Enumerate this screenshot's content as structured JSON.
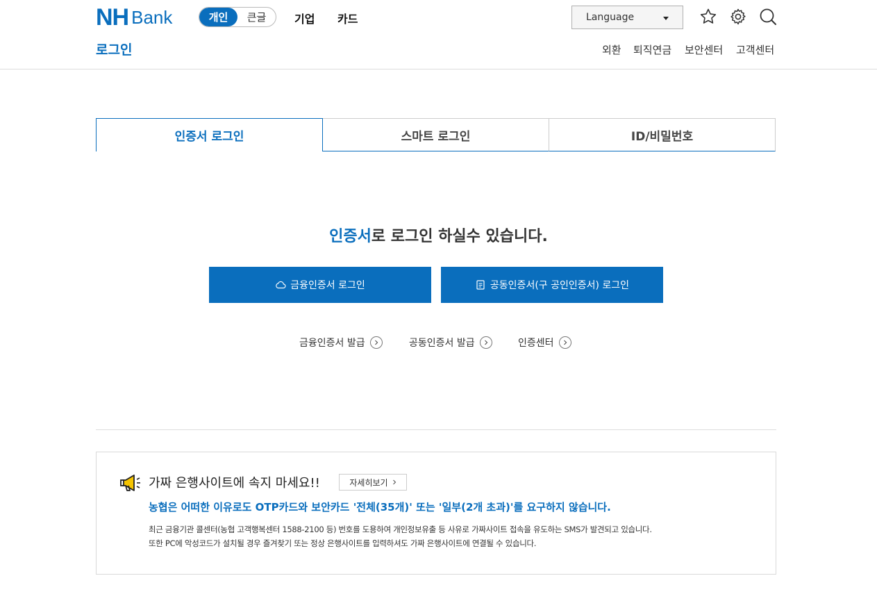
{
  "header": {
    "logo_nh": "NH",
    "logo_bank": "Bank",
    "toggle": {
      "personal": "개인",
      "large_text": "큰글"
    },
    "gnb": [
      "기업",
      "카드"
    ],
    "language": "Language",
    "page_title": "로그인",
    "subnav": [
      "외환",
      "퇴직연금",
      "보안센터",
      "고객센터"
    ]
  },
  "tabs": [
    "인증서 로그인",
    "스마트 로그인",
    "ID/비밀번호"
  ],
  "main": {
    "headline_em": "인증서",
    "headline_rest": "로 로그인 하실수 있습니다.",
    "buttons": [
      "금융인증서 로그인",
      "공동인증서(구 공인인증서) 로그인"
    ],
    "links": [
      "금융인증서 발급",
      "공동인증서 발급",
      "인증센터"
    ]
  },
  "notice": {
    "title": "가짜 은행사이트에 속지 마세요!!",
    "detail_btn": "자세히보기",
    "alert": "농협은 어떠한 이유로도 OTP카드와 보안카드 '전체(35개)' 또는 '일부(2개 초과)'를 요구하지 않습니다.",
    "body1": "최근 금융기관 콜센터(농협 고객행복센터 1588-2100 등) 번호를 도용하여 개인정보유출 등 사유로 가짜사이트 접속을 유도하는 SMS가 발견되고 있습니다.",
    "body2": "또한 PC에 악성코드가 설치될 경우 즐겨찾기 또는 정상 은행사이트를 입력하셔도 가짜 은행사이트에 연결될 수 있습니다."
  },
  "colors": {
    "brand": "#0a6ebd"
  }
}
